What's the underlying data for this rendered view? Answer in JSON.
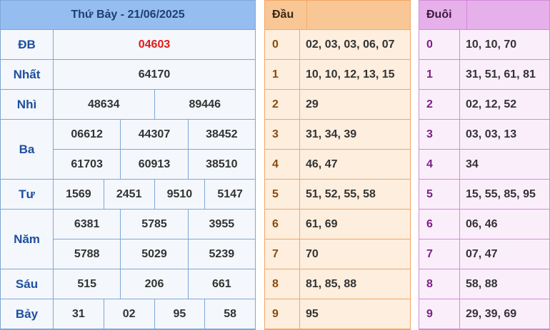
{
  "results": {
    "title": "Thứ Bảy - 21/06/2025",
    "rows": [
      {
        "label": "ĐB",
        "values": [
          "04603"
        ]
      },
      {
        "label": "Nhất",
        "values": [
          "64170"
        ]
      },
      {
        "label": "Nhì",
        "values": [
          "48634",
          "89446"
        ]
      },
      {
        "label": "Ba",
        "values": [
          "06612",
          "44307",
          "38452",
          "61703",
          "60913",
          "38510"
        ]
      },
      {
        "label": "Tư",
        "values": [
          "1569",
          "2451",
          "9510",
          "5147"
        ]
      },
      {
        "label": "Năm",
        "values": [
          "6381",
          "5785",
          "3955",
          "5788",
          "5029",
          "5239"
        ]
      },
      {
        "label": "Sáu",
        "values": [
          "515",
          "206",
          "661"
        ]
      },
      {
        "label": "Bảy",
        "values": [
          "31",
          "02",
          "95",
          "58"
        ]
      }
    ]
  },
  "dau": {
    "title": "Đầu",
    "rows": [
      {
        "key": "0",
        "value": "02, 03, 03, 06, 07"
      },
      {
        "key": "1",
        "value": "10, 10, 12, 13, 15"
      },
      {
        "key": "2",
        "value": "29"
      },
      {
        "key": "3",
        "value": "31, 34, 39"
      },
      {
        "key": "4",
        "value": "46, 47"
      },
      {
        "key": "5",
        "value": "51, 52, 55, 58"
      },
      {
        "key": "6",
        "value": "61, 69"
      },
      {
        "key": "7",
        "value": "70"
      },
      {
        "key": "8",
        "value": "81, 85, 88"
      },
      {
        "key": "9",
        "value": "95"
      }
    ]
  },
  "duoi": {
    "title": "Đuôi",
    "rows": [
      {
        "key": "0",
        "value": "10, 10, 70"
      },
      {
        "key": "1",
        "value": "31, 51, 61, 81"
      },
      {
        "key": "2",
        "value": "02, 12, 52"
      },
      {
        "key": "3",
        "value": "03, 03, 13"
      },
      {
        "key": "4",
        "value": "34"
      },
      {
        "key": "5",
        "value": "15, 55, 85, 95"
      },
      {
        "key": "6",
        "value": "06, 46"
      },
      {
        "key": "7",
        "value": "07, 47"
      },
      {
        "key": "8",
        "value": "58, 88"
      },
      {
        "key": "9",
        "value": "29, 39, 69"
      }
    ]
  },
  "colors": {
    "special_prize": "#e01b1b",
    "results_header": "#96bdf0",
    "dau_header": "#f9c796",
    "duoi_header": "#e6b0ea"
  }
}
